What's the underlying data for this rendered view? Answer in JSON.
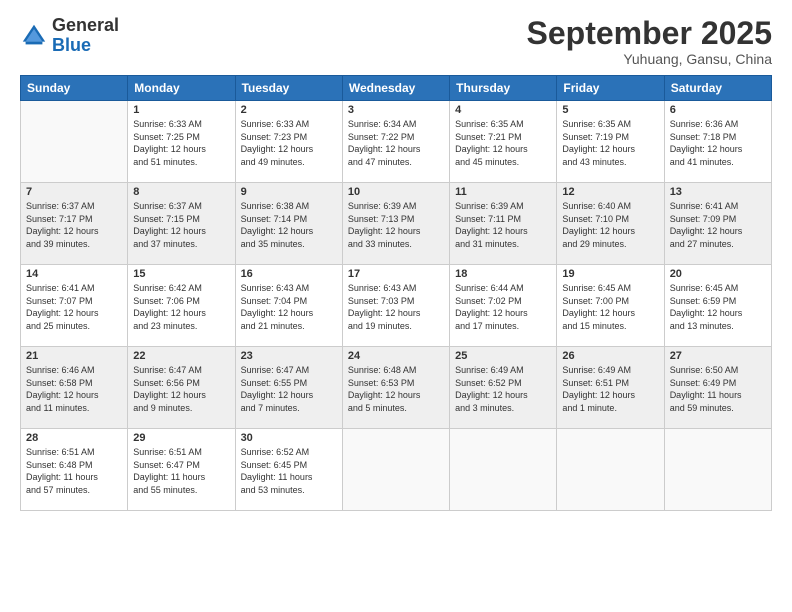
{
  "header": {
    "logo": {
      "line1": "General",
      "line2": "Blue"
    },
    "month": "September 2025",
    "location": "Yuhuang, Gansu, China"
  },
  "days_of_week": [
    "Sunday",
    "Monday",
    "Tuesday",
    "Wednesday",
    "Thursday",
    "Friday",
    "Saturday"
  ],
  "weeks": [
    [
      {
        "day": "",
        "info": ""
      },
      {
        "day": "1",
        "info": "Sunrise: 6:33 AM\nSunset: 7:25 PM\nDaylight: 12 hours\nand 51 minutes."
      },
      {
        "day": "2",
        "info": "Sunrise: 6:33 AM\nSunset: 7:23 PM\nDaylight: 12 hours\nand 49 minutes."
      },
      {
        "day": "3",
        "info": "Sunrise: 6:34 AM\nSunset: 7:22 PM\nDaylight: 12 hours\nand 47 minutes."
      },
      {
        "day": "4",
        "info": "Sunrise: 6:35 AM\nSunset: 7:21 PM\nDaylight: 12 hours\nand 45 minutes."
      },
      {
        "day": "5",
        "info": "Sunrise: 6:35 AM\nSunset: 7:19 PM\nDaylight: 12 hours\nand 43 minutes."
      },
      {
        "day": "6",
        "info": "Sunrise: 6:36 AM\nSunset: 7:18 PM\nDaylight: 12 hours\nand 41 minutes."
      }
    ],
    [
      {
        "day": "7",
        "info": "Sunrise: 6:37 AM\nSunset: 7:17 PM\nDaylight: 12 hours\nand 39 minutes."
      },
      {
        "day": "8",
        "info": "Sunrise: 6:37 AM\nSunset: 7:15 PM\nDaylight: 12 hours\nand 37 minutes."
      },
      {
        "day": "9",
        "info": "Sunrise: 6:38 AM\nSunset: 7:14 PM\nDaylight: 12 hours\nand 35 minutes."
      },
      {
        "day": "10",
        "info": "Sunrise: 6:39 AM\nSunset: 7:13 PM\nDaylight: 12 hours\nand 33 minutes."
      },
      {
        "day": "11",
        "info": "Sunrise: 6:39 AM\nSunset: 7:11 PM\nDaylight: 12 hours\nand 31 minutes."
      },
      {
        "day": "12",
        "info": "Sunrise: 6:40 AM\nSunset: 7:10 PM\nDaylight: 12 hours\nand 29 minutes."
      },
      {
        "day": "13",
        "info": "Sunrise: 6:41 AM\nSunset: 7:09 PM\nDaylight: 12 hours\nand 27 minutes."
      }
    ],
    [
      {
        "day": "14",
        "info": "Sunrise: 6:41 AM\nSunset: 7:07 PM\nDaylight: 12 hours\nand 25 minutes."
      },
      {
        "day": "15",
        "info": "Sunrise: 6:42 AM\nSunset: 7:06 PM\nDaylight: 12 hours\nand 23 minutes."
      },
      {
        "day": "16",
        "info": "Sunrise: 6:43 AM\nSunset: 7:04 PM\nDaylight: 12 hours\nand 21 minutes."
      },
      {
        "day": "17",
        "info": "Sunrise: 6:43 AM\nSunset: 7:03 PM\nDaylight: 12 hours\nand 19 minutes."
      },
      {
        "day": "18",
        "info": "Sunrise: 6:44 AM\nSunset: 7:02 PM\nDaylight: 12 hours\nand 17 minutes."
      },
      {
        "day": "19",
        "info": "Sunrise: 6:45 AM\nSunset: 7:00 PM\nDaylight: 12 hours\nand 15 minutes."
      },
      {
        "day": "20",
        "info": "Sunrise: 6:45 AM\nSunset: 6:59 PM\nDaylight: 12 hours\nand 13 minutes."
      }
    ],
    [
      {
        "day": "21",
        "info": "Sunrise: 6:46 AM\nSunset: 6:58 PM\nDaylight: 12 hours\nand 11 minutes."
      },
      {
        "day": "22",
        "info": "Sunrise: 6:47 AM\nSunset: 6:56 PM\nDaylight: 12 hours\nand 9 minutes."
      },
      {
        "day": "23",
        "info": "Sunrise: 6:47 AM\nSunset: 6:55 PM\nDaylight: 12 hours\nand 7 minutes."
      },
      {
        "day": "24",
        "info": "Sunrise: 6:48 AM\nSunset: 6:53 PM\nDaylight: 12 hours\nand 5 minutes."
      },
      {
        "day": "25",
        "info": "Sunrise: 6:49 AM\nSunset: 6:52 PM\nDaylight: 12 hours\nand 3 minutes."
      },
      {
        "day": "26",
        "info": "Sunrise: 6:49 AM\nSunset: 6:51 PM\nDaylight: 12 hours\nand 1 minute."
      },
      {
        "day": "27",
        "info": "Sunrise: 6:50 AM\nSunset: 6:49 PM\nDaylight: 11 hours\nand 59 minutes."
      }
    ],
    [
      {
        "day": "28",
        "info": "Sunrise: 6:51 AM\nSunset: 6:48 PM\nDaylight: 11 hours\nand 57 minutes."
      },
      {
        "day": "29",
        "info": "Sunrise: 6:51 AM\nSunset: 6:47 PM\nDaylight: 11 hours\nand 55 minutes."
      },
      {
        "day": "30",
        "info": "Sunrise: 6:52 AM\nSunset: 6:45 PM\nDaylight: 11 hours\nand 53 minutes."
      },
      {
        "day": "",
        "info": ""
      },
      {
        "day": "",
        "info": ""
      },
      {
        "day": "",
        "info": ""
      },
      {
        "day": "",
        "info": ""
      }
    ]
  ]
}
